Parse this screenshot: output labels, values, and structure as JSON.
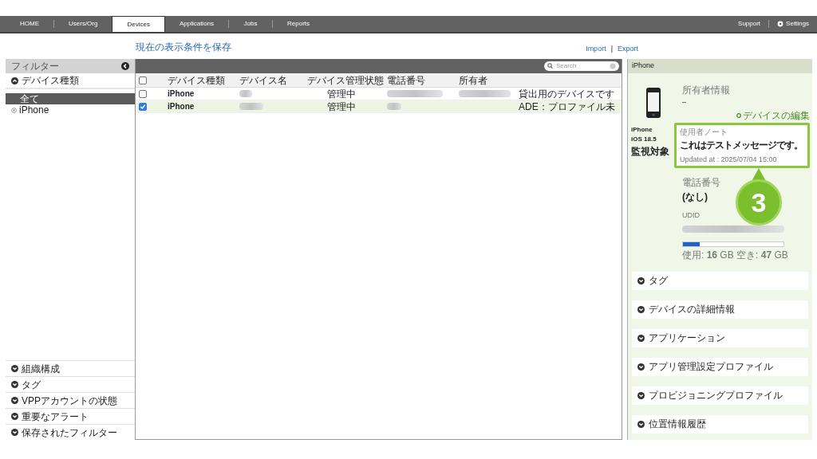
{
  "nav": {
    "tabs": [
      {
        "label": "HOME",
        "selected": false
      },
      {
        "label": "Users/Org",
        "selected": false
      },
      {
        "label": "Devices",
        "selected": true
      },
      {
        "label": "Applications",
        "selected": false
      },
      {
        "label": "Jobs",
        "selected": false
      },
      {
        "label": "Reports",
        "selected": false
      }
    ],
    "right": {
      "support": "Support",
      "settings": "Settings"
    }
  },
  "toolbar": {
    "save_view": "現在の表示条件を保存",
    "import": "Import",
    "separator": "|",
    "export": "Export"
  },
  "filter": {
    "title": "フィルター",
    "device_type": {
      "label": "デバイス種類",
      "expanded": true,
      "options": [
        {
          "label": "全て",
          "selected": true
        },
        {
          "label": "iPhone",
          "selected": false
        }
      ]
    },
    "sections": [
      {
        "label": "組織構成",
        "expanded": false
      },
      {
        "label": "タグ",
        "expanded": false
      },
      {
        "label": "VPPアカウントの状態",
        "expanded": false
      },
      {
        "label": "重要なアラート",
        "expanded": false
      },
      {
        "label": "保存されたフィルター",
        "expanded": false
      }
    ]
  },
  "table": {
    "search": {
      "placeholder": "Search"
    },
    "select_all": {
      "checked": false
    },
    "columns": [
      "デバイス種類",
      "デバイス名",
      "デバイス管理状態",
      "電話番号",
      "所有者"
    ],
    "rows": [
      {
        "selected": false,
        "type": "iPhone",
        "status": "管理中",
        "column_7": "貸出用のデバイスです"
      },
      {
        "selected": true,
        "type": "iPhone",
        "status": "管理中",
        "column_7": "ADE：プロファイル未"
      }
    ]
  },
  "detail": {
    "title": "iPhone",
    "device": {
      "model": "iPhone",
      "os": "iOS 18.5",
      "supervision": "監視対象"
    },
    "owner": {
      "label": "所有者情報",
      "value": "–"
    },
    "edit_link": "デバイスの編集",
    "user_note": {
      "label": "使用者ノート",
      "text": "これはテストメッセージです。",
      "updated": "Updated at : 2025/07/04 15:00"
    },
    "phone": {
      "label": "電話番号",
      "value": "(なし)"
    },
    "udid": {
      "label": "UDID"
    },
    "storage": {
      "level": 0.17,
      "text": "使用: **16** GB  空き: **47** GB"
    },
    "sections": [
      {
        "label": "タグ",
        "expanded": false
      },
      {
        "label": "デバイスの詳細情報",
        "expanded": false
      },
      {
        "label": "アプリケーション",
        "expanded": false
      },
      {
        "label": "アプリ管理設定プロファイル",
        "expanded": false
      },
      {
        "label": "プロビジョニングプロファイル",
        "expanded": false
      },
      {
        "label": "位置情報履歴",
        "expanded": false
      }
    ]
  },
  "callout": {
    "label": "3"
  }
}
